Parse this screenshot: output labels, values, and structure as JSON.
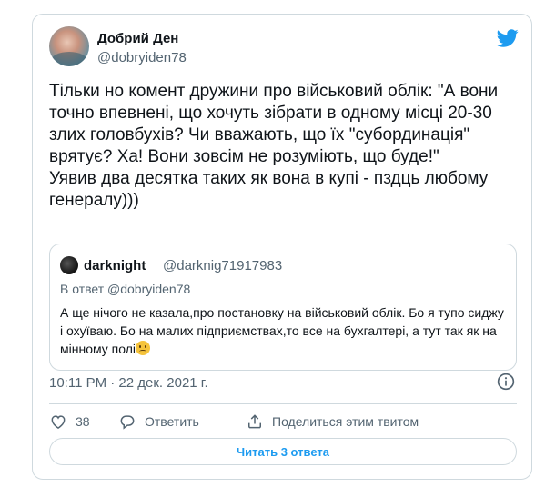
{
  "author": {
    "display_name": "Добрий Ден",
    "username": "@dobryiden78"
  },
  "tweet": {
    "text": "Тільки но комент дружини про військовий облік: \"А вони точно впевнені, що хочуть зібрати в одному місці 20-30 злих головбухів? Чи вважають, що їх \"субординація\" врятує? Ха! Вони зовсім не розуміють, що буде!\"\nУявив два десятка таких як вона в купі - пздць любому генералу)))",
    "timestamp": "10:11 PM · 22 дек. 2021 г."
  },
  "quoted_tweet": {
    "display_name": "darknight",
    "username": "@darknig71917983",
    "reply_context": "В ответ @dobryiden78",
    "text": "А ще нічого не казала,про постановку на військовий облік. Бо я тупо сиджу і охуїваю. Бо на малих підприємствах,то все на бухгалтері, а тут так як на мінному полі"
  },
  "actions": {
    "like_count": "38",
    "reply_label": "Ответить",
    "share_label": "Поделиться этим твитом"
  },
  "footer": {
    "read_replies_label": "Читать 3 ответа"
  },
  "icons": {
    "brand": "twitter-bird-icon",
    "info": "info-icon",
    "like": "heart-icon",
    "reply": "speech-bubble-icon",
    "share": "upload-icon",
    "emoji": "sad-face-emoji"
  },
  "colors": {
    "accent": "#1d9bf0",
    "text": "#0f1419",
    "secondary": "#536471",
    "border": "#cfd9de"
  }
}
